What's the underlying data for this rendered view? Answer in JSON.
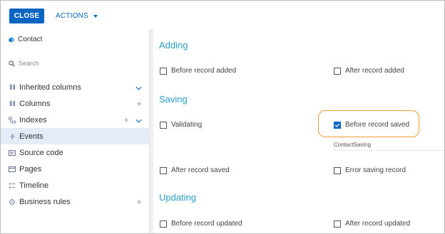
{
  "toolbar": {
    "close_label": "CLOSE",
    "actions_label": "ACTIONS"
  },
  "sidebar": {
    "header": "Contact",
    "search_placeholder": "Search",
    "items": [
      {
        "label": "Inherited columns",
        "icon": "columns-icon"
      },
      {
        "label": "Columns",
        "icon": "columns-icon"
      },
      {
        "label": "Indexes",
        "icon": "indexes-icon"
      },
      {
        "label": "Events",
        "icon": "lightning-icon"
      },
      {
        "label": "Source code",
        "icon": "source-code-icon"
      },
      {
        "label": "Pages",
        "icon": "page-icon"
      },
      {
        "label": "Timeline",
        "icon": "timeline-icon"
      },
      {
        "label": "Business rules",
        "icon": "business-rules-icon"
      }
    ]
  },
  "events": {
    "adding": {
      "title": "Adding",
      "before_record_added": "Before record added",
      "after_record_added": "After record added"
    },
    "saving": {
      "title": "Saving",
      "validating": "Validating",
      "before_record_saved": "Before record saved",
      "before_record_saved_checked": true,
      "method_name": "ContactSaving",
      "after_record_saved": "After record saved",
      "error_saving_record": "Error saving record"
    },
    "updating": {
      "title": "Updating",
      "before_record_updated": "Before record updated",
      "after_record_updated": "After record updated"
    }
  },
  "colors": {
    "accent": "#0a66c2",
    "section_title": "#28a0c9",
    "highlight": "#ef9a3c",
    "active_row": "#e3ecf7"
  }
}
